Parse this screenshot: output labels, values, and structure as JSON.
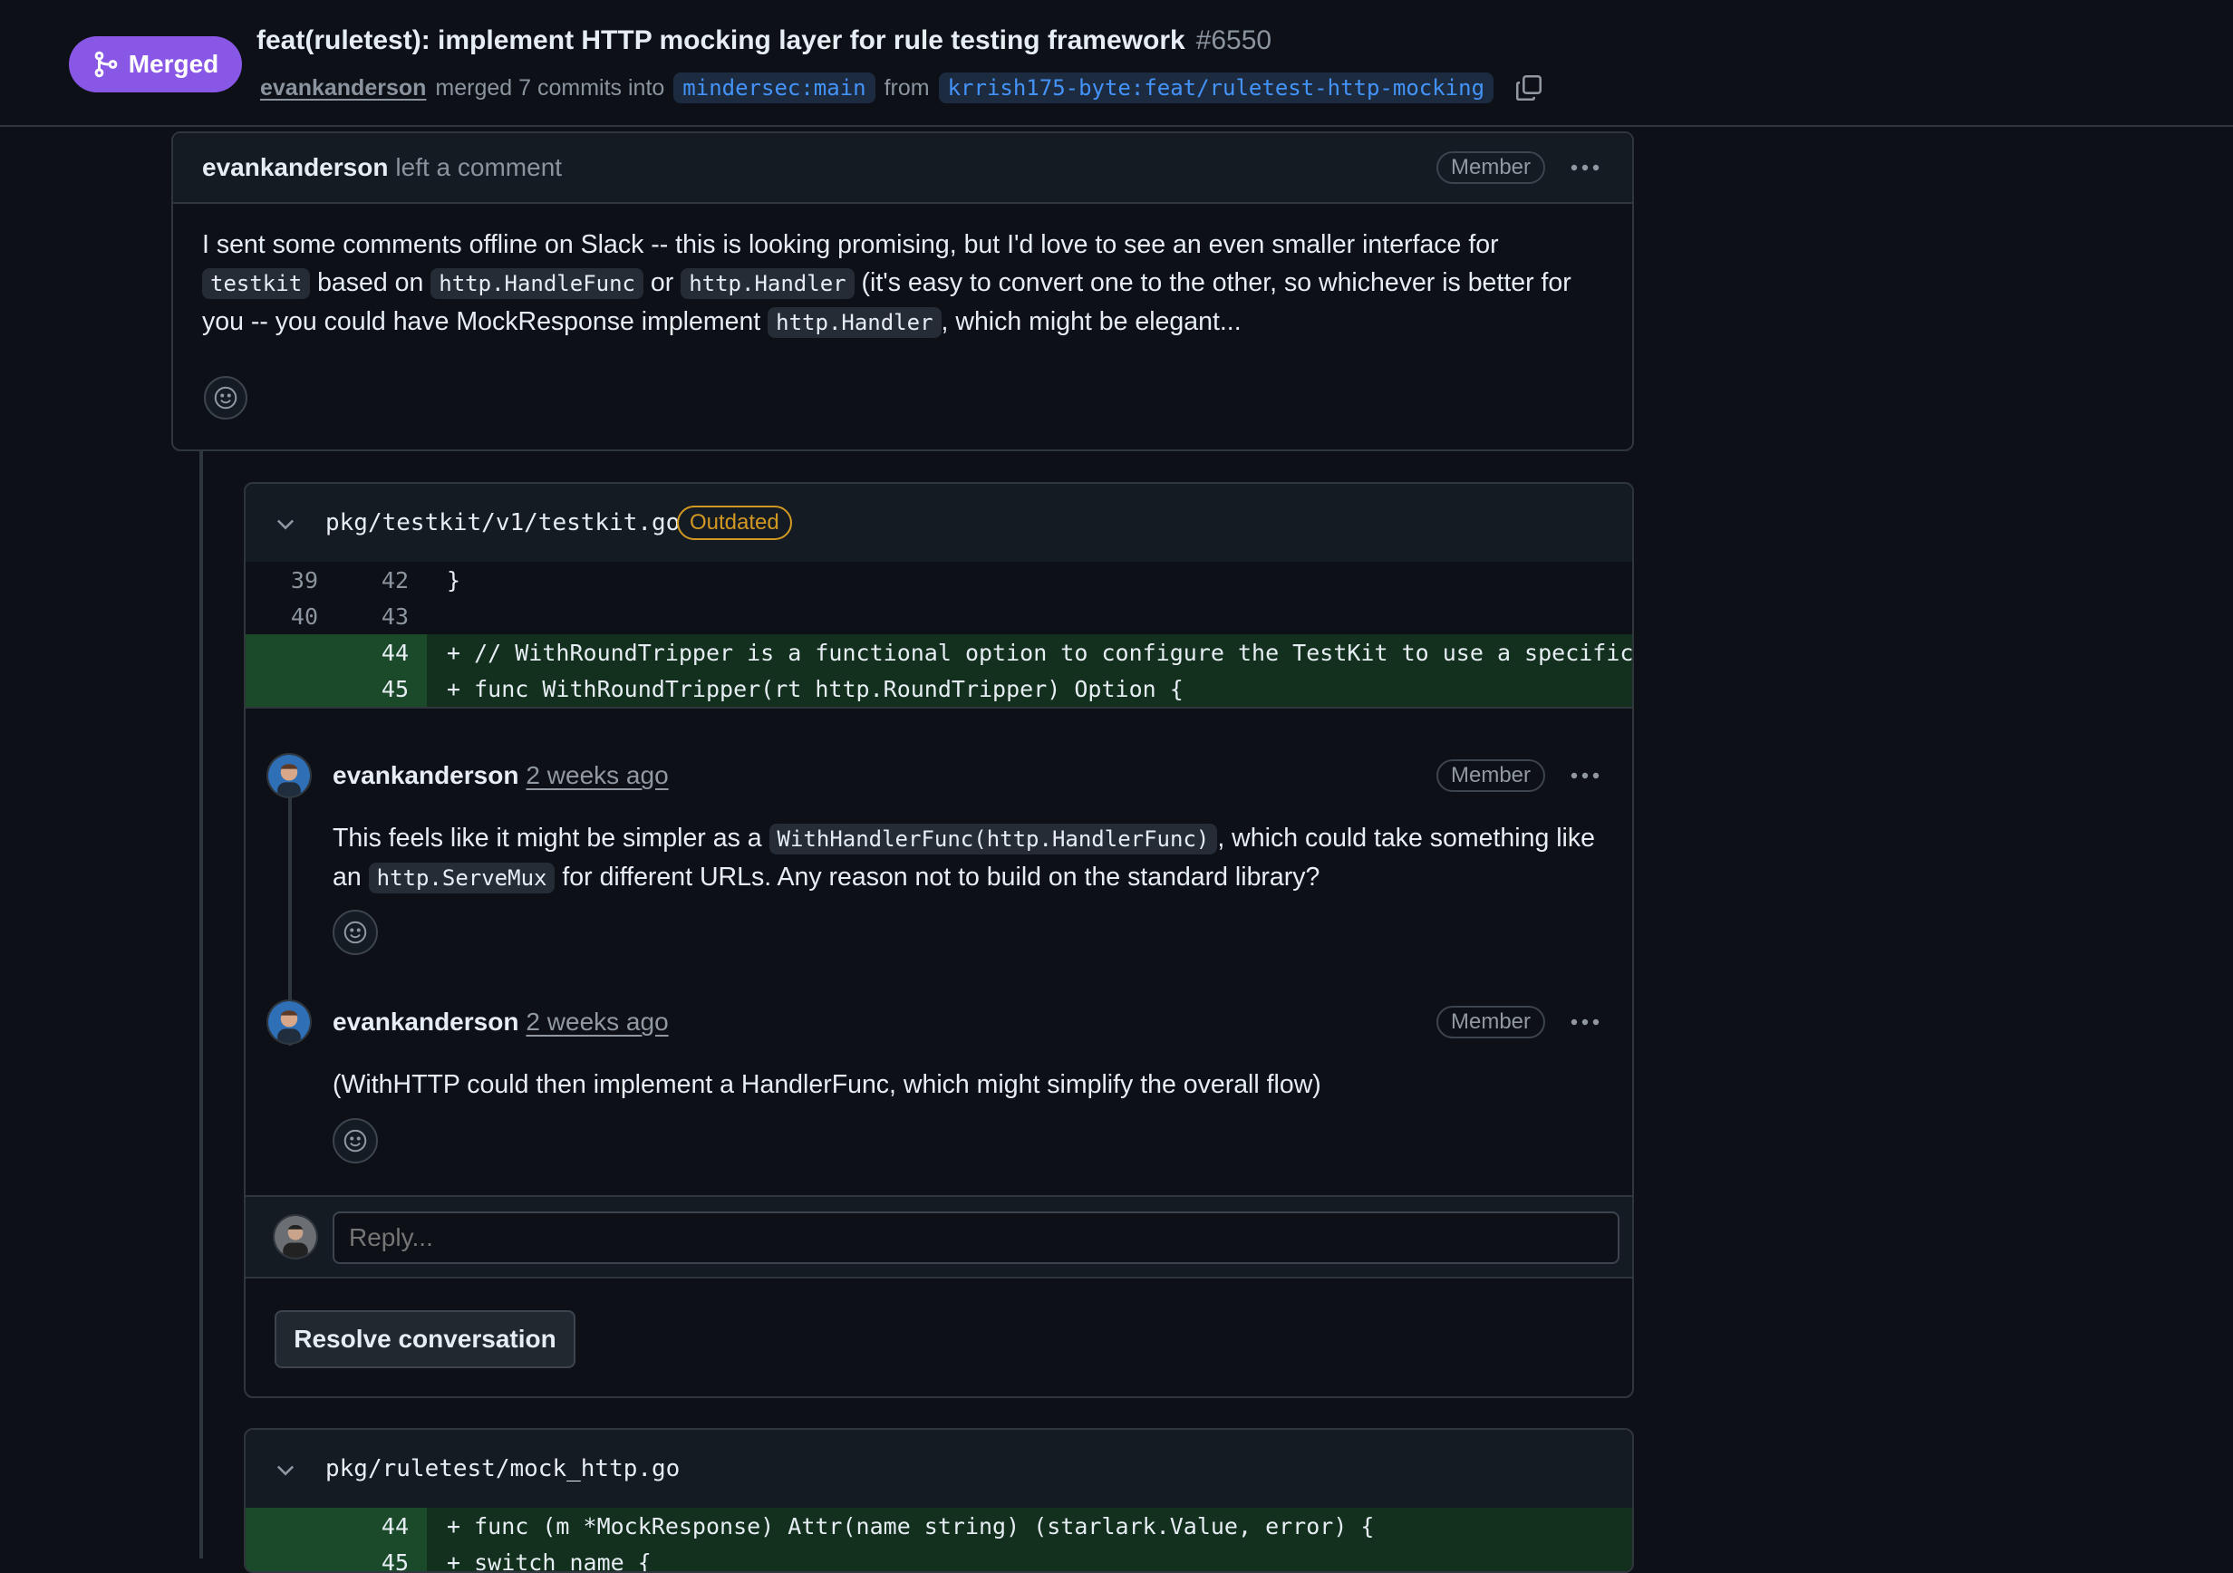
{
  "pr": {
    "status": "Merged",
    "title": "feat(ruletest): implement HTTP mocking layer for rule testing framework",
    "number": "#6550",
    "author": "evankanderson",
    "merge_text": "merged 7 commits into",
    "base_branch": "mindersec:main",
    "from_text": "from",
    "head_branch": "krrish175-byte:feat/ruletest-http-mocking"
  },
  "top_comment": {
    "author": "evankanderson",
    "action": "left a comment",
    "badge": "Member",
    "body": {
      "t1": "I sent some comments offline on Slack -- this is looking promising, but I'd love to see an even smaller interface for ",
      "c1": "testkit",
      "t2": " based on ",
      "c2": "http.HandleFunc",
      "t3": " or ",
      "c3": "http.Handler",
      "t4": " (it's easy to convert one to the other, so whichever is better for you -- you could have MockResponse implement ",
      "c4": "http.Handler",
      "t5": ", which might be elegant..."
    }
  },
  "thread1": {
    "file": "pkg/testkit/v1/testkit.go",
    "badge": "Outdated",
    "lines": [
      {
        "old": "39",
        "new": "42",
        "code": "  }",
        "type": "ctx"
      },
      {
        "old": "40",
        "new": "43",
        "code": "",
        "type": "ctx"
      },
      {
        "old": "",
        "new": "44",
        "code": "+ // WithRoundTripper is a functional option to configure the TestKit to use a specific R",
        "type": "add"
      },
      {
        "old": "",
        "new": "45",
        "code": "+ func WithRoundTripper(rt http.RoundTripper) Option {",
        "type": "add"
      }
    ],
    "comments": [
      {
        "author": "evankanderson",
        "time": "2 weeks ago",
        "badge": "Member",
        "t1": "This feels like it might be simpler as a ",
        "c1": "WithHandlerFunc(http.HandlerFunc)",
        "t2": ", which could take something like an ",
        "c2": "http.ServeMux",
        "t3": " for different URLs. Any reason not to build on the standard library?"
      },
      {
        "author": "evankanderson",
        "time": "2 weeks ago",
        "badge": "Member",
        "text": "(WithHTTP could then implement a HandlerFunc, which might simplify the overall flow)"
      }
    ],
    "reply_placeholder": "Reply...",
    "resolve_label": "Resolve conversation"
  },
  "thread2": {
    "file": "pkg/ruletest/mock_http.go",
    "lines": [
      {
        "new": "44",
        "code": "+ func (m *MockResponse) Attr(name string) (starlark.Value, error) {",
        "type": "add"
      },
      {
        "new": "45",
        "code": "+     switch name {",
        "type": "add"
      }
    ]
  },
  "colors": {
    "merged": "#8957e5",
    "background": "#0d1117",
    "addition": "#12301d",
    "link": "#4493f8",
    "outdated": "#d29922"
  },
  "icons": [
    "git-merge-icon",
    "copy-icon",
    "kebab-menu-icon",
    "smiley-icon",
    "chevron-down-icon",
    "avatar"
  ]
}
